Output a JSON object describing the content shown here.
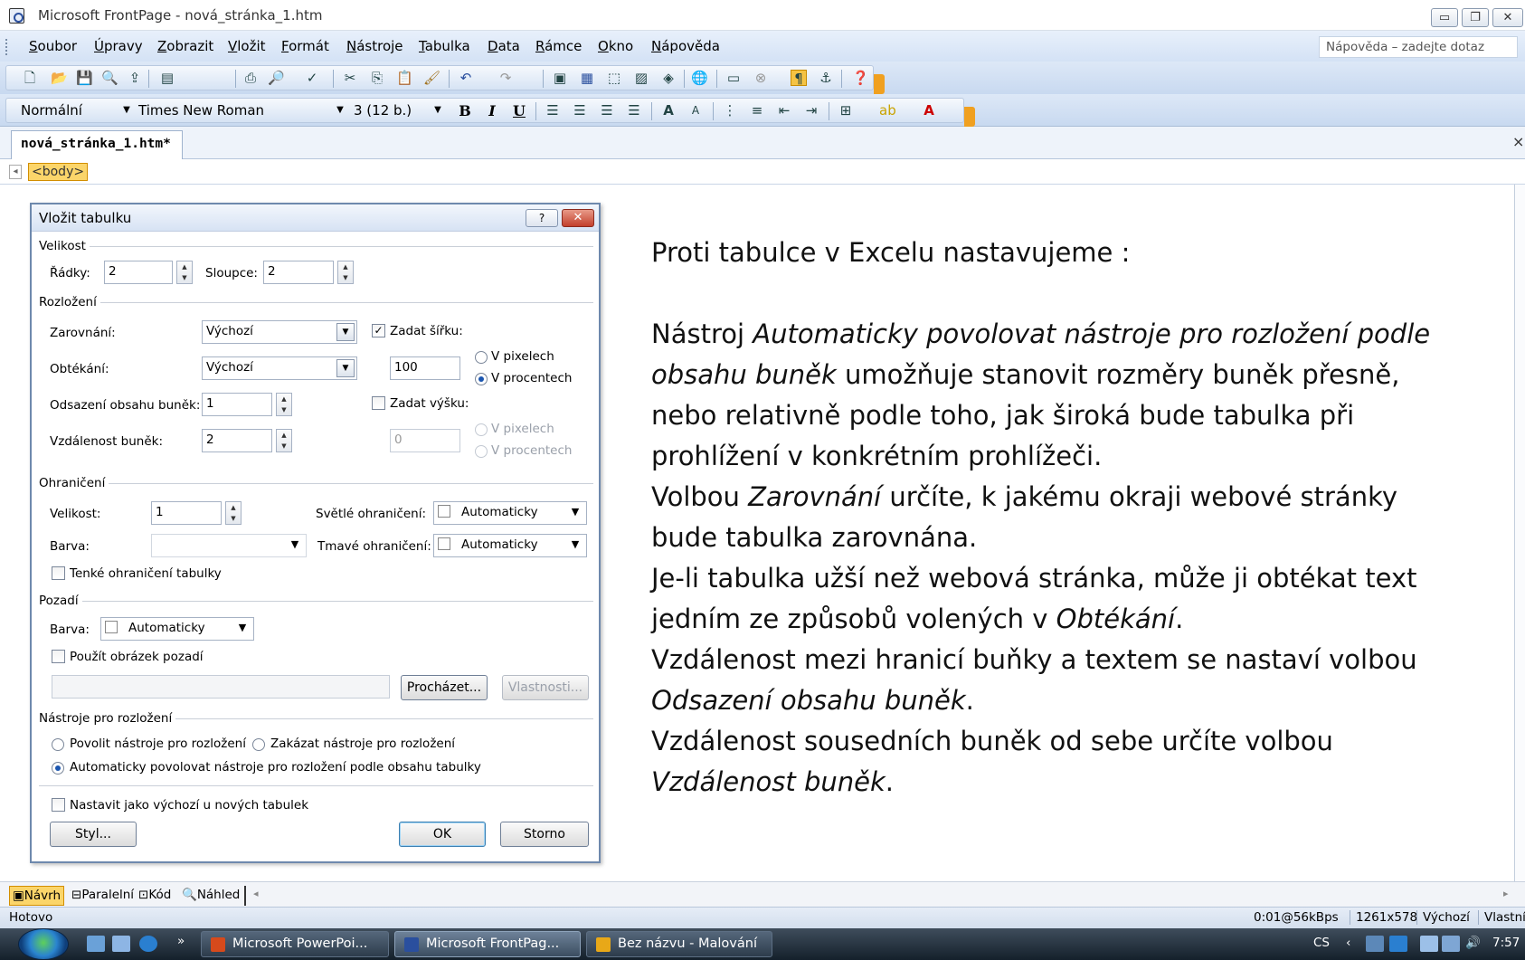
{
  "window": {
    "title": "Microsoft FrontPage - nová_stránka_1.htm",
    "min_glyph": "▭",
    "restore_glyph": "❐",
    "close_glyph": "✕"
  },
  "menubar": {
    "items": [
      "Soubor",
      "Úpravy",
      "Zobrazit",
      "Vložit",
      "Formát",
      "Nástroje",
      "Tabulka",
      "Data",
      "Rámce",
      "Okno",
      "Nápověda"
    ],
    "help_placeholder": "Nápověda – zadejte dotaz"
  },
  "format_toolbar": {
    "style": "Normální",
    "font": "Times New Roman",
    "size": "3 (12 b.)",
    "bold": "B",
    "italic": "I",
    "underline": "U"
  },
  "document": {
    "tab_label": "nová_stránka_1.htm*",
    "tag": "<body>"
  },
  "dialog": {
    "title": "Vložit tabulku",
    "help": "?",
    "close": "✕",
    "size_group": "Velikost",
    "rows_label": "Řádky:",
    "rows_value": "2",
    "cols_label": "Sloupce:",
    "cols_value": "2",
    "layout_group": "Rozložení",
    "align_label": "Zarovnání:",
    "align_value": "Výchozí",
    "wrap_label": "Obtékání:",
    "wrap_value": "Výchozí",
    "padding_label": "Odsazení obsahu buněk:",
    "padding_value": "1",
    "spacing_label": "Vzdálenost buněk:",
    "spacing_value": "2",
    "width_check_label": "Zadat šířku:",
    "width_value": "100",
    "width_pixels": "V pixelech",
    "width_percent": "V procentech",
    "height_check_label": "Zadat výšku:",
    "height_value": "0",
    "height_pixels": "V pixelech",
    "height_percent": "V procentech",
    "borders_group": "Ohraničení",
    "border_size_label": "Velikost:",
    "border_size_value": "1",
    "border_color_label": "Barva:",
    "light_border_label": "Světlé ohraničení:",
    "light_border_value": "Automaticky",
    "dark_border_label": "Tmavé ohraničení:",
    "dark_border_value": "Automaticky",
    "thin_borders": "Tenké ohraničení tabulky",
    "background_group": "Pozadí",
    "bg_color_label": "Barva:",
    "bg_color_value": "Automaticky",
    "bg_image_check": "Použít obrázek pozadí",
    "browse_button": "Procházet...",
    "properties_button": "Vlastnosti...",
    "layout_tools_group": "Nástroje pro rozložení",
    "enable_tools": "Povolit nástroje pro rozložení",
    "disable_tools": "Zakázat nástroje pro rozložení",
    "auto_tools": "Automaticky povolovat nástroje pro rozložení podle obsahu tabulky",
    "set_default": "Nastavit jako výchozí u nových tabulek",
    "style_button": "Styl...",
    "ok_button": "OK",
    "cancel_button": "Storno"
  },
  "content": {
    "line1": "Proti tabulce v Excelu nastavujeme :",
    "p1_a": "Nástroj ",
    "p1_b": "Automaticky povolovat nástroje pro rozložení podle",
    "p1_c": "obsahu buněk",
    "p1_d": " umožňuje stanovit rozměry buněk přesně,",
    "p1_e": "nebo relativně podle toho, jak široká bude tabulka při",
    "p1_f": "prohlížení v konkrétním prohlížeči.",
    "p2_a": "Volbou ",
    "p2_b": "Zarovnání",
    "p2_c": " určíte, k jakému okraji webové stránky",
    "p2_d": "bude tabulka zarovnána.",
    "p3_a": "Je-li tabulka užší než webová stránka, může ji obtékat text",
    "p3_b": "jedním ze způsobů volených v ",
    "p3_c": "Obtékání",
    "p3_d": ".",
    "p4_a": "Vzdálenost mezi hranicí buňky a textem se nastaví volbou",
    "p4_b": "Odsazení obsahu buněk",
    "p4_c": ".",
    "p5_a": "Vzdálenost sousedních buněk od sebe určíte volbou",
    "p5_b": "Vzdálenost buněk",
    "p5_c": "."
  },
  "viewbar": {
    "design": "Návrh",
    "split": "Paralelní",
    "code": "Kód",
    "preview": "Náhled"
  },
  "statusbar": {
    "status": "Hotovo",
    "speed": "0:01@56kBps",
    "resolution": "1261x578",
    "mode": "Výchozí",
    "custom": "Vlastní"
  },
  "taskbar": {
    "tasks": [
      "Microsoft PowerPoi...",
      "Microsoft FrontPag...",
      "Bez názvu - Malování"
    ],
    "more": "»",
    "lang": "CS",
    "time": "7:57"
  },
  "colors": {
    "accent": "#fbd56a",
    "title_bg": "#d4e2f5",
    "close_red": "#c3402c"
  }
}
